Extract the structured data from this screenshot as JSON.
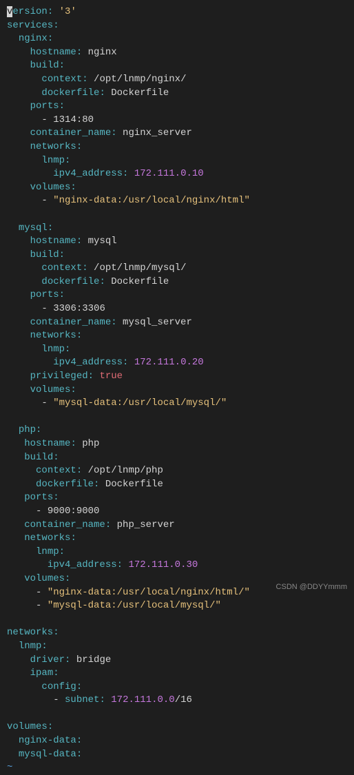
{
  "yaml": {
    "version_key": "ersion",
    "version_first": "v",
    "version_val": "'3'",
    "services": "services",
    "nginx": {
      "name": "nginx",
      "hostname_key": "hostname",
      "hostname_val": "nginx",
      "build_key": "build",
      "context_key": "context",
      "context_val": "/opt/lnmp/nginx/",
      "dockerfile_key": "dockerfile",
      "dockerfile_val": "Dockerfile",
      "ports_key": "ports",
      "ports_val": "1314:80",
      "container_name_key": "container_name",
      "container_name_val": "nginx_server",
      "networks_key": "networks",
      "lnmp_key": "lnmp",
      "ipv4_key": "ipv4_address",
      "ipv4_val": "172.111.0.10",
      "volumes_key": "volumes",
      "volume_val": "\"nginx-data:/usr/local/nginx/html\""
    },
    "mysql": {
      "name": "mysql",
      "hostname_key": "hostname",
      "hostname_val": "mysql",
      "build_key": "build",
      "context_key": "context",
      "context_val": "/opt/lnmp/mysql/",
      "dockerfile_key": "dockerfile",
      "dockerfile_val": "Dockerfile",
      "ports_key": "ports",
      "ports_val": "3306:3306",
      "container_name_key": "container_name",
      "container_name_val": "mysql_server",
      "networks_key": "networks",
      "lnmp_key": "lnmp",
      "ipv4_key": "ipv4_address",
      "ipv4_val": "172.111.0.20",
      "privileged_key": "privileged",
      "privileged_val": "true",
      "volumes_key": "volumes",
      "volume_val": "\"mysql-data:/usr/local/mysql/\""
    },
    "php": {
      "name": "php",
      "hostname_key": "hostname",
      "hostname_val": "php",
      "build_key": "build",
      "context_key": "context",
      "context_val": "/opt/lnmp/php",
      "dockerfile_key": "dockerfile",
      "dockerfile_val": "Dockerfile",
      "ports_key": "ports",
      "ports_val": "9000:9000",
      "container_name_key": "container_name",
      "container_name_val": "php_server",
      "networks_key": "networks",
      "lnmp_key": "lnmp",
      "ipv4_key": "ipv4_address",
      "ipv4_val": "172.111.0.30",
      "volumes_key": "volumes",
      "volume1_val": "\"nginx-data:/usr/local/nginx/html/\"",
      "volume2_val": "\"mysql-data:/usr/local/mysql/\""
    },
    "networks": {
      "key": "networks",
      "lnmp_key": "lnmp",
      "driver_key": "driver",
      "driver_val": "bridge",
      "ipam_key": "ipam",
      "config_key": "config",
      "subnet_key": "subnet",
      "subnet_ip": "172.111.0.0",
      "subnet_mask": "/16"
    },
    "volumes": {
      "key": "volumes",
      "nginx_data": "nginx-data",
      "mysql_data": "mysql-data"
    },
    "tilde": "~"
  },
  "watermark": "CSDN @DDYYmmm"
}
